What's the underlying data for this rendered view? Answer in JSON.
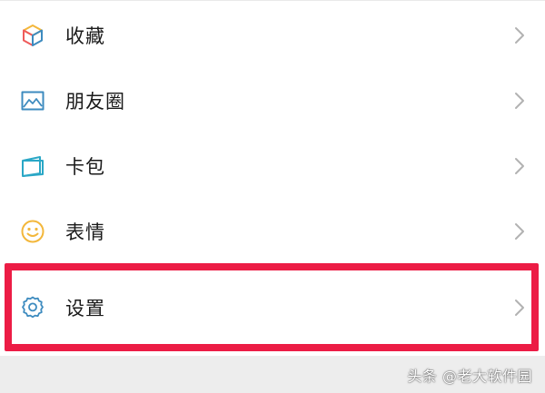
{
  "menu": {
    "items": [
      {
        "label": "收藏",
        "icon": "cube-icon"
      },
      {
        "label": "朋友圈",
        "icon": "picture-icon"
      },
      {
        "label": "卡包",
        "icon": "wallet-icon"
      },
      {
        "label": "表情",
        "icon": "smiley-icon"
      },
      {
        "label": "设置",
        "icon": "gear-icon"
      }
    ]
  },
  "watermark": {
    "text": "头条 @老大软件园"
  },
  "colors": {
    "highlight": "#ec1c45",
    "chevron": "#b2b2b2",
    "icon_blue": "#3d8bbf",
    "icon_yellow": "#f3b73b",
    "icon_red": "#ef5b5b",
    "icon_teal": "#2aa7c6"
  }
}
